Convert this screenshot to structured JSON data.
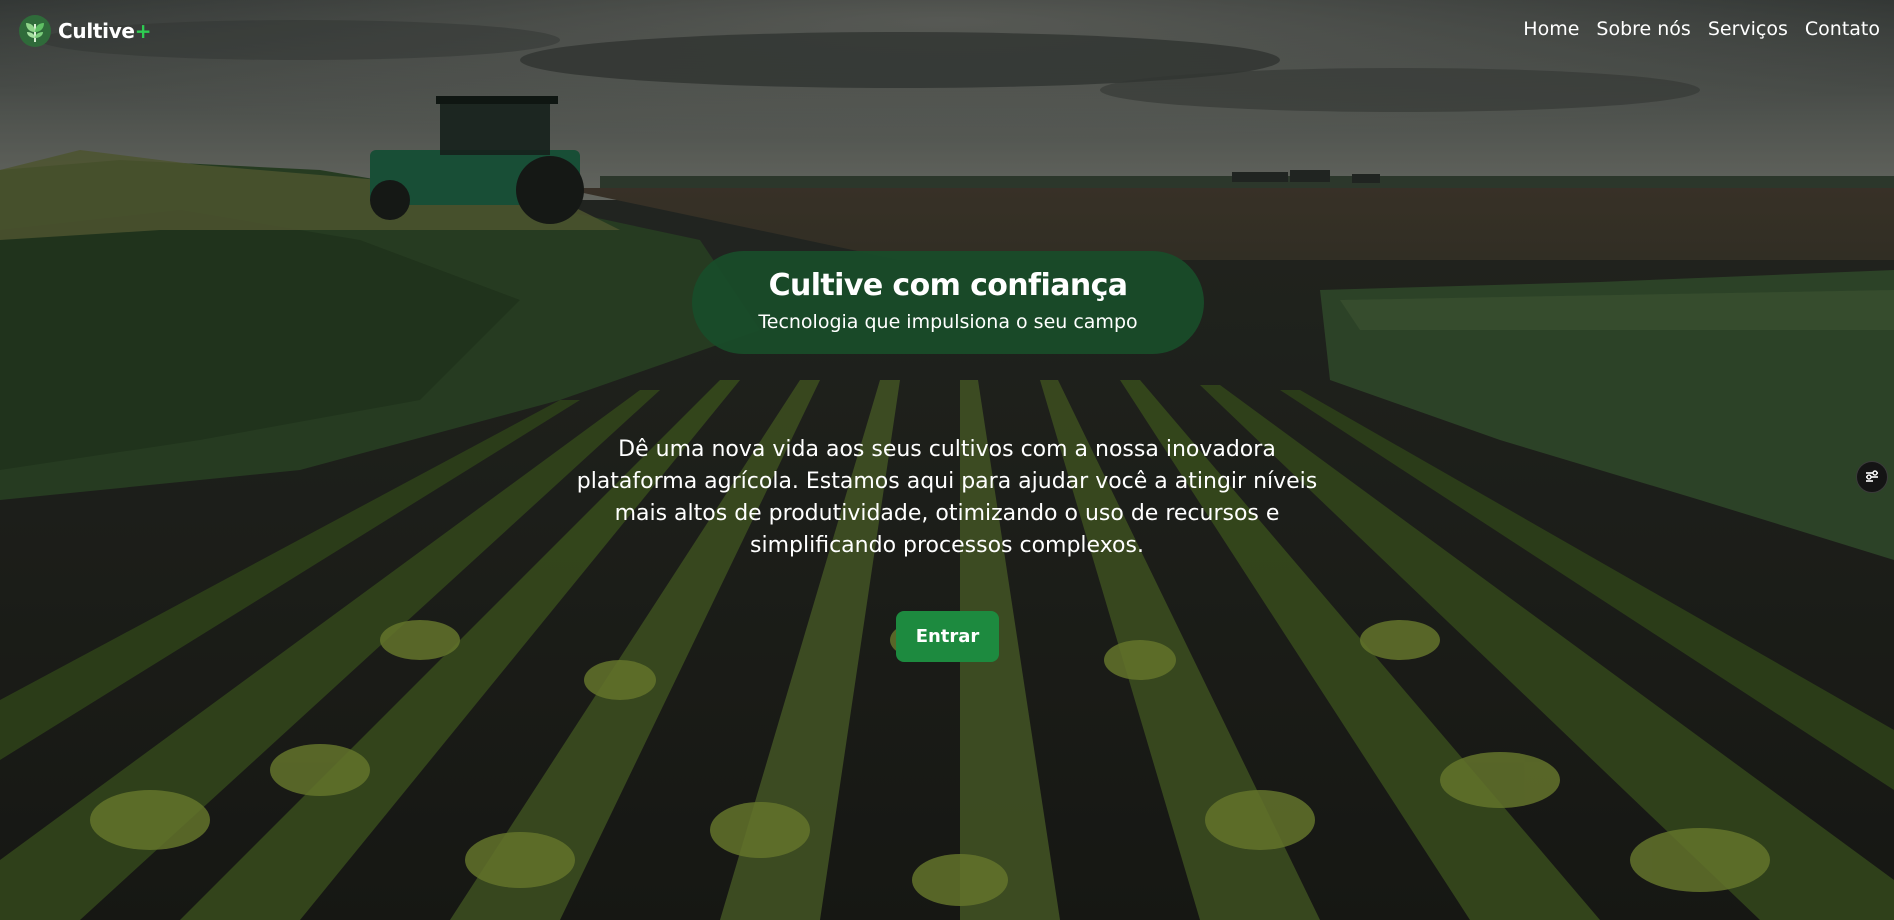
{
  "brand": {
    "name": "Cultive",
    "plus": "+",
    "logo_icon": "leaf-sprout-icon",
    "accent_color": "#2ecc52"
  },
  "nav": {
    "items": [
      {
        "label": "Home"
      },
      {
        "label": "Sobre nós"
      },
      {
        "label": "Serviços"
      },
      {
        "label": "Contato"
      }
    ]
  },
  "hero": {
    "title": "Cultive com confiança",
    "subtitle": "Tecnologia que impulsiona o seu campo",
    "description": "Dê uma nova vida aos seus cultivos com a nossa inovadora plataforma agrícola. Estamos aqui para ajudar você a atingir níveis mais altos de produtividade, otimizando o uso de recursos e simplificando processos complexos.",
    "cta_label": "Entrar",
    "pill_color": "#184e2a",
    "cta_color": "#1d8a3f"
  },
  "side_widget": {
    "icon": "sliders-toggle-icon"
  }
}
